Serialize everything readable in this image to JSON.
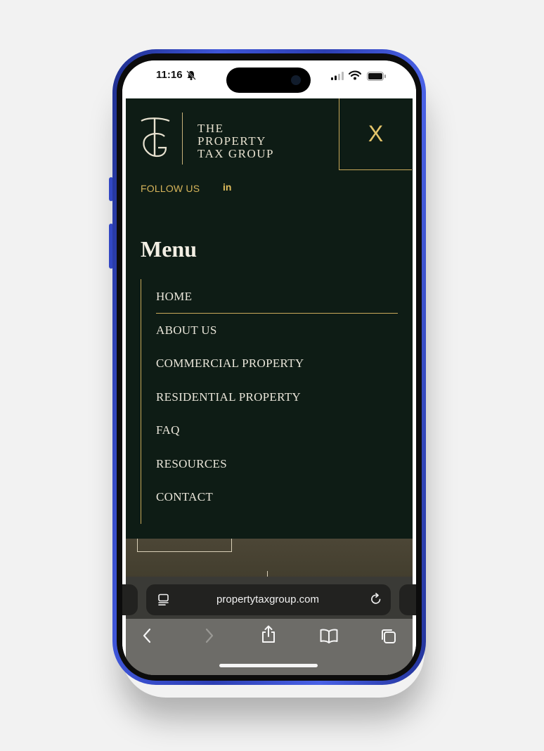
{
  "status": {
    "time": "11:16"
  },
  "brand": {
    "monogram": "TG",
    "name_lines": [
      "THE",
      "PROPERTY",
      "TAX GROUP"
    ]
  },
  "header": {
    "close_label": "X",
    "follow_label": "FOLLOW US",
    "social_label": "in"
  },
  "menu": {
    "title": "Menu",
    "items": [
      {
        "label": "HOME"
      },
      {
        "label": "ABOUT US"
      },
      {
        "label": "COMMERCIAL PROPERTY"
      },
      {
        "label": "RESIDENTIAL PROPERTY"
      },
      {
        "label": "FAQ"
      },
      {
        "label": "RESOURCES"
      },
      {
        "label": "CONTACT"
      }
    ]
  },
  "browser": {
    "url": "propertytaxgroup.com",
    "toolbar_icons": [
      "back-icon",
      "forward-icon",
      "share-icon",
      "bookmarks-icon",
      "tabs-icon"
    ]
  },
  "colors": {
    "menu_background": "#0e1c15",
    "accent_gold": "#c9a95a",
    "phone_frame": "#3247c4"
  }
}
